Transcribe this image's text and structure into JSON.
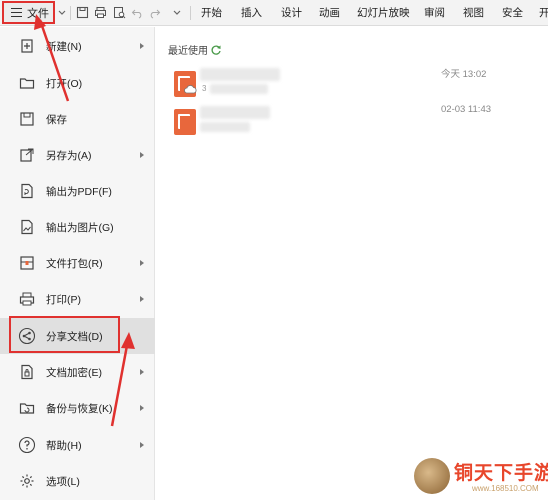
{
  "toolbar": {
    "file_label": "文件",
    "menus": [
      "开始",
      "插入",
      "设计",
      "动画",
      "幻灯片放映",
      "审阅",
      "视图",
      "安全",
      "开"
    ]
  },
  "sidebar": {
    "items": [
      {
        "label": "新建(N)",
        "icon": "new-icon",
        "has_arrow": true
      },
      {
        "label": "打开(O)",
        "icon": "folder-icon",
        "has_arrow": false
      },
      {
        "label": "保存",
        "icon": "save-icon",
        "has_arrow": false
      },
      {
        "label": "另存为(A)",
        "icon": "save-as-icon",
        "has_arrow": true
      },
      {
        "label": "输出为PDF(F)",
        "icon": "pdf-icon",
        "has_arrow": false
      },
      {
        "label": "输出为图片(G)",
        "icon": "image-icon",
        "has_arrow": false
      },
      {
        "label": "文件打包(R)",
        "icon": "package-icon",
        "has_arrow": true
      },
      {
        "label": "打印(P)",
        "icon": "print-icon",
        "has_arrow": true
      },
      {
        "label": "分享文档(D)",
        "icon": "share-icon",
        "has_arrow": false,
        "selected": true
      },
      {
        "label": "文档加密(E)",
        "icon": "lock-icon",
        "has_arrow": true
      },
      {
        "label": "备份与恢复(K)",
        "icon": "backup-icon",
        "has_arrow": true
      },
      {
        "label": "帮助(H)",
        "icon": "help-icon",
        "has_arrow": true
      },
      {
        "label": "选项(L)",
        "icon": "gear-icon",
        "has_arrow": false
      }
    ]
  },
  "recent": {
    "title": "最近使用",
    "files": [
      {
        "time": "今天 13:02",
        "sub": "3"
      },
      {
        "time": "02-03 11:43",
        "sub": ""
      }
    ]
  },
  "watermark": {
    "text": "铜天下手游",
    "url": "www.168510.COM"
  },
  "colors": {
    "accent_red": "#e0312f",
    "doc_orange": "#e8673c"
  }
}
